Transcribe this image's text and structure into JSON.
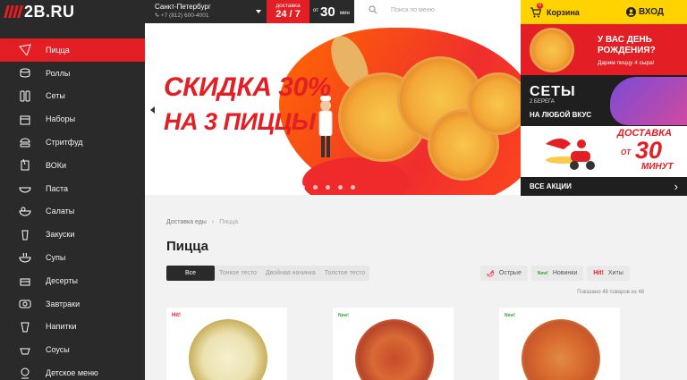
{
  "header": {
    "logo_text": "2B.RU",
    "city": "Санкт-Петербург",
    "phone": "+7 (812) 600-4001",
    "delivery_label": "доставка",
    "delivery_hours": "24 / 7",
    "delivery_from": "от",
    "delivery_minutes": "30",
    "delivery_unit": "мин",
    "search_placeholder": "Поиск по меню",
    "cart_label": "Корзина",
    "cart_count": "0",
    "login_label": "ВХОД"
  },
  "sidebar": {
    "items": [
      {
        "label": "Пицца",
        "icon": "pizza-icon",
        "active": true
      },
      {
        "label": "Роллы",
        "icon": "rolls-icon"
      },
      {
        "label": "Сеты",
        "icon": "sets-icon"
      },
      {
        "label": "Наборы",
        "icon": "box-icon"
      },
      {
        "label": "Стритфуд",
        "icon": "burger-icon"
      },
      {
        "label": "ВОКи",
        "icon": "wok-icon"
      },
      {
        "label": "Паста",
        "icon": "pasta-icon"
      },
      {
        "label": "Салаты",
        "icon": "salad-icon"
      },
      {
        "label": "Закуски",
        "icon": "snack-icon"
      },
      {
        "label": "Супы",
        "icon": "soup-icon"
      },
      {
        "label": "Десерты",
        "icon": "dessert-icon"
      },
      {
        "label": "Завтраки",
        "icon": "breakfast-icon"
      },
      {
        "label": "Напитки",
        "icon": "drink-icon"
      },
      {
        "label": "Соусы",
        "icon": "sauce-icon"
      },
      {
        "label": "Детское меню",
        "icon": "kids-icon"
      }
    ]
  },
  "hero": {
    "promo_line1": "СКИДКА 30%",
    "promo_line2": "НА 3 ПИЦЦЫ",
    "slide_count": 6,
    "active_slide": 0
  },
  "promos": {
    "birthday_title": "У ВАС ДЕНЬ РОЖДЕНИЯ?",
    "birthday_sub": "Дарим пиццу 4 сыра!",
    "sets_title": "СЕТЫ",
    "sets_sub": "2 БЕРЕГА",
    "sets_line": "НА ЛЮБОЙ ВКУС",
    "delivery_word": "ДОСТАВКА",
    "delivery_from": "ОТ",
    "delivery_num": "30",
    "delivery_unit": "МИНУТ",
    "all_promos": "ВСЕ АКЦИИ"
  },
  "content": {
    "breadcrumb_home": "Доставка еды",
    "breadcrumb_current": "Пицца",
    "title": "Пицца",
    "filters": [
      "Все",
      "Тонкое тесто",
      "Двойная начинка",
      "Толстое тесто"
    ],
    "tags": [
      {
        "mark": "🌶",
        "label": "Острые"
      },
      {
        "mark": "New!",
        "label": "Новинки"
      },
      {
        "mark": "Hit!",
        "label": "Хиты"
      }
    ],
    "shown_count": "Показано 48 товаров из 48",
    "cards": [
      {
        "badge": "Hit!",
        "badge_type": "hit"
      },
      {
        "badge": "New!",
        "badge_type": "new"
      },
      {
        "badge": "New!",
        "badge_type": "new"
      }
    ]
  },
  "colors": {
    "brand_red": "#e31e24",
    "sidebar_bg": "#2a2a2a",
    "accent_yellow": "#ffd200"
  }
}
